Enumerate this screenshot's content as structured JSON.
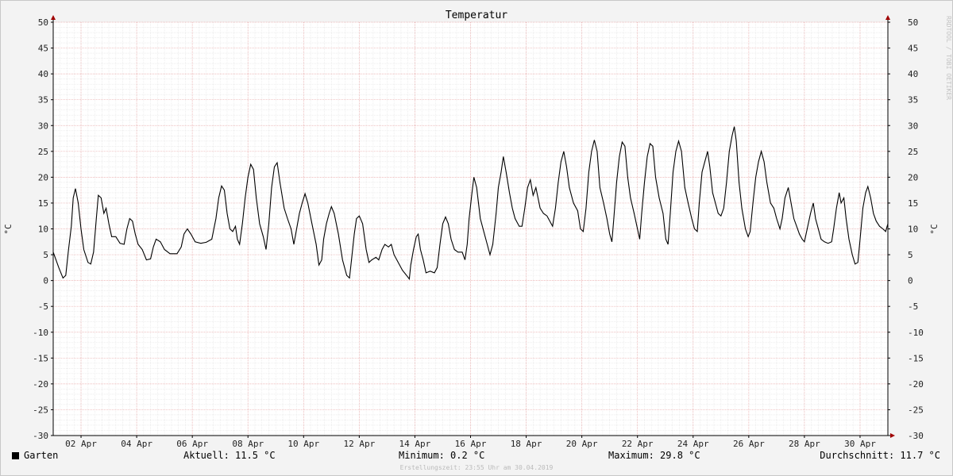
{
  "chart_data": {
    "type": "line",
    "title": "Temperatur",
    "ylabel": "°C",
    "ylabel_right": "°C",
    "ylim": [
      -30,
      50
    ],
    "yticks": [
      50,
      45,
      40,
      35,
      30,
      25,
      20,
      15,
      10,
      5,
      0,
      -5,
      -10,
      -15,
      -20,
      -25,
      -30
    ],
    "xlim": [
      1,
      31
    ],
    "xticks": [
      {
        "x": 2,
        "label": "02 Apr"
      },
      {
        "x": 4,
        "label": "04 Apr"
      },
      {
        "x": 6,
        "label": "06 Apr"
      },
      {
        "x": 8,
        "label": "08 Apr"
      },
      {
        "x": 10,
        "label": "10 Apr"
      },
      {
        "x": 12,
        "label": "12 Apr"
      },
      {
        "x": 14,
        "label": "14 Apr"
      },
      {
        "x": 16,
        "label": "16 Apr"
      },
      {
        "x": 18,
        "label": "18 Apr"
      },
      {
        "x": 20,
        "label": "20 Apr"
      },
      {
        "x": 22,
        "label": "22 Apr"
      },
      {
        "x": 24,
        "label": "24 Apr"
      },
      {
        "x": 26,
        "label": "26 Apr"
      },
      {
        "x": 28,
        "label": "28 Apr"
      },
      {
        "x": 30,
        "label": "30 Apr"
      }
    ],
    "grid": true,
    "series": [
      {
        "name": "Garten",
        "color": "#000000",
        "points": [
          [
            1.0,
            5.5
          ],
          [
            1.2,
            2.5
          ],
          [
            1.35,
            0.5
          ],
          [
            1.45,
            1.0
          ],
          [
            1.55,
            6
          ],
          [
            1.65,
            10.5
          ],
          [
            1.72,
            16
          ],
          [
            1.8,
            17.8
          ],
          [
            1.9,
            15
          ],
          [
            2.0,
            10
          ],
          [
            2.1,
            6
          ],
          [
            2.25,
            3.5
          ],
          [
            2.35,
            3.2
          ],
          [
            2.45,
            5.5
          ],
          [
            2.55,
            12
          ],
          [
            2.62,
            16.5
          ],
          [
            2.72,
            16
          ],
          [
            2.82,
            13
          ],
          [
            2.9,
            14
          ],
          [
            3.0,
            11
          ],
          [
            3.1,
            8.5
          ],
          [
            3.25,
            8.5
          ],
          [
            3.4,
            7.2
          ],
          [
            3.55,
            7
          ],
          [
            3.65,
            10
          ],
          [
            3.75,
            12
          ],
          [
            3.85,
            11.5
          ],
          [
            3.95,
            9
          ],
          [
            4.05,
            7
          ],
          [
            4.2,
            6
          ],
          [
            4.35,
            4
          ],
          [
            4.5,
            4.2
          ],
          [
            4.6,
            6.5
          ],
          [
            4.7,
            8
          ],
          [
            4.85,
            7.5
          ],
          [
            5.0,
            6
          ],
          [
            5.2,
            5.2
          ],
          [
            5.45,
            5.2
          ],
          [
            5.6,
            6.5
          ],
          [
            5.7,
            9
          ],
          [
            5.82,
            10
          ],
          [
            5.95,
            9
          ],
          [
            6.1,
            7.5
          ],
          [
            6.3,
            7.2
          ],
          [
            6.5,
            7.4
          ],
          [
            6.7,
            8
          ],
          [
            6.85,
            12
          ],
          [
            6.95,
            16
          ],
          [
            7.05,
            18.3
          ],
          [
            7.15,
            17.5
          ],
          [
            7.25,
            13
          ],
          [
            7.35,
            10
          ],
          [
            7.45,
            9.5
          ],
          [
            7.55,
            10.5
          ],
          [
            7.62,
            8
          ],
          [
            7.7,
            7
          ],
          [
            7.8,
            11
          ],
          [
            7.9,
            16
          ],
          [
            8.0,
            20
          ],
          [
            8.1,
            22.5
          ],
          [
            8.2,
            21.5
          ],
          [
            8.3,
            16
          ],
          [
            8.42,
            11
          ],
          [
            8.55,
            8.5
          ],
          [
            8.65,
            6
          ],
          [
            8.75,
            11
          ],
          [
            8.85,
            18
          ],
          [
            8.95,
            22
          ],
          [
            9.05,
            22.8
          ],
          [
            9.15,
            19
          ],
          [
            9.3,
            14
          ],
          [
            9.42,
            12
          ],
          [
            9.55,
            10
          ],
          [
            9.65,
            7
          ],
          [
            9.75,
            10
          ],
          [
            9.85,
            13
          ],
          [
            9.95,
            15
          ],
          [
            10.05,
            16.8
          ],
          [
            10.15,
            15
          ],
          [
            10.3,
            11
          ],
          [
            10.45,
            7
          ],
          [
            10.55,
            3
          ],
          [
            10.65,
            4
          ],
          [
            10.72,
            8
          ],
          [
            10.82,
            11
          ],
          [
            10.92,
            13
          ],
          [
            11.0,
            14.3
          ],
          [
            11.1,
            13
          ],
          [
            11.25,
            9
          ],
          [
            11.4,
            4
          ],
          [
            11.55,
            1
          ],
          [
            11.65,
            0.5
          ],
          [
            11.72,
            4
          ],
          [
            11.82,
            9
          ],
          [
            11.9,
            12
          ],
          [
            12.0,
            12.5
          ],
          [
            12.12,
            11
          ],
          [
            12.25,
            6
          ],
          [
            12.35,
            3.5
          ],
          [
            12.45,
            4
          ],
          [
            12.6,
            4.5
          ],
          [
            12.7,
            4
          ],
          [
            12.82,
            6
          ],
          [
            12.92,
            7
          ],
          [
            13.05,
            6.5
          ],
          [
            13.15,
            7
          ],
          [
            13.25,
            5
          ],
          [
            13.4,
            3.5
          ],
          [
            13.55,
            2
          ],
          [
            13.7,
            1
          ],
          [
            13.8,
            0.3
          ],
          [
            13.85,
            3
          ],
          [
            13.95,
            6
          ],
          [
            14.05,
            8.5
          ],
          [
            14.12,
            9
          ],
          [
            14.2,
            6
          ],
          [
            14.3,
            4
          ],
          [
            14.4,
            1.5
          ],
          [
            14.55,
            1.8
          ],
          [
            14.7,
            1.5
          ],
          [
            14.8,
            2.5
          ],
          [
            14.9,
            7
          ],
          [
            15.0,
            11
          ],
          [
            15.1,
            12.3
          ],
          [
            15.2,
            11
          ],
          [
            15.3,
            8
          ],
          [
            15.42,
            6
          ],
          [
            15.55,
            5.5
          ],
          [
            15.7,
            5.5
          ],
          [
            15.8,
            4
          ],
          [
            15.88,
            7
          ],
          [
            15.95,
            12
          ],
          [
            16.05,
            17
          ],
          [
            16.12,
            20
          ],
          [
            16.22,
            18
          ],
          [
            16.35,
            12
          ],
          [
            16.5,
            9
          ],
          [
            16.6,
            7
          ],
          [
            16.7,
            5
          ],
          [
            16.8,
            7
          ],
          [
            16.92,
            13
          ],
          [
            17.0,
            18
          ],
          [
            17.1,
            21
          ],
          [
            17.18,
            24
          ],
          [
            17.28,
            21
          ],
          [
            17.4,
            17
          ],
          [
            17.5,
            14
          ],
          [
            17.6,
            12
          ],
          [
            17.75,
            10.5
          ],
          [
            17.85,
            10.5
          ],
          [
            17.95,
            14
          ],
          [
            18.05,
            18
          ],
          [
            18.15,
            19.5
          ],
          [
            18.25,
            16.5
          ],
          [
            18.35,
            18
          ],
          [
            18.5,
            14
          ],
          [
            18.62,
            13
          ],
          [
            18.75,
            12.5
          ],
          [
            18.85,
            11.5
          ],
          [
            18.95,
            10.5
          ],
          [
            19.05,
            14
          ],
          [
            19.15,
            19
          ],
          [
            19.25,
            23
          ],
          [
            19.35,
            25
          ],
          [
            19.45,
            22
          ],
          [
            19.55,
            18
          ],
          [
            19.7,
            15
          ],
          [
            19.85,
            13.5
          ],
          [
            19.95,
            10
          ],
          [
            20.05,
            9.5
          ],
          [
            20.15,
            14
          ],
          [
            20.25,
            21
          ],
          [
            20.35,
            25
          ],
          [
            20.45,
            27.2
          ],
          [
            20.55,
            25
          ],
          [
            20.65,
            18
          ],
          [
            20.78,
            15
          ],
          [
            20.9,
            12
          ],
          [
            21.0,
            9
          ],
          [
            21.08,
            7.5
          ],
          [
            21.15,
            12
          ],
          [
            21.25,
            19
          ],
          [
            21.35,
            24
          ],
          [
            21.45,
            26.8
          ],
          [
            21.55,
            26
          ],
          [
            21.65,
            20
          ],
          [
            21.75,
            16
          ],
          [
            21.88,
            13
          ],
          [
            22.0,
            10
          ],
          [
            22.08,
            8
          ],
          [
            22.15,
            13
          ],
          [
            22.25,
            19
          ],
          [
            22.35,
            24
          ],
          [
            22.45,
            26.5
          ],
          [
            22.55,
            26
          ],
          [
            22.65,
            20
          ],
          [
            22.78,
            16
          ],
          [
            22.92,
            13
          ],
          [
            23.02,
            8
          ],
          [
            23.1,
            7
          ],
          [
            23.18,
            13
          ],
          [
            23.28,
            21
          ],
          [
            23.38,
            25
          ],
          [
            23.48,
            27
          ],
          [
            23.58,
            25
          ],
          [
            23.7,
            18
          ],
          [
            23.82,
            15
          ],
          [
            23.95,
            12
          ],
          [
            24.05,
            10
          ],
          [
            24.15,
            9.5
          ],
          [
            24.22,
            15
          ],
          [
            24.32,
            21
          ],
          [
            24.42,
            23
          ],
          [
            24.52,
            25
          ],
          [
            24.6,
            22
          ],
          [
            24.7,
            17
          ],
          [
            24.8,
            15
          ],
          [
            24.9,
            13
          ],
          [
            25.0,
            12.5
          ],
          [
            25.1,
            14
          ],
          [
            25.2,
            19
          ],
          [
            25.3,
            25
          ],
          [
            25.4,
            28
          ],
          [
            25.48,
            29.8
          ],
          [
            25.55,
            27
          ],
          [
            25.65,
            19
          ],
          [
            25.75,
            14
          ],
          [
            25.88,
            10
          ],
          [
            25.98,
            8.5
          ],
          [
            26.05,
            9.5
          ],
          [
            26.15,
            15
          ],
          [
            26.25,
            20
          ],
          [
            26.35,
            23
          ],
          [
            26.45,
            25
          ],
          [
            26.55,
            23
          ],
          [
            26.65,
            19
          ],
          [
            26.78,
            15
          ],
          [
            26.9,
            14
          ],
          [
            27.0,
            12
          ],
          [
            27.12,
            10
          ],
          [
            27.2,
            12
          ],
          [
            27.3,
            16
          ],
          [
            27.42,
            18
          ],
          [
            27.52,
            15
          ],
          [
            27.62,
            12
          ],
          [
            27.72,
            10.5
          ],
          [
            27.82,
            9
          ],
          [
            27.92,
            8
          ],
          [
            28.0,
            7.5
          ],
          [
            28.1,
            10
          ],
          [
            28.22,
            13
          ],
          [
            28.32,
            15
          ],
          [
            28.4,
            12
          ],
          [
            28.5,
            10
          ],
          [
            28.6,
            8
          ],
          [
            28.72,
            7.5
          ],
          [
            28.85,
            7.2
          ],
          [
            28.98,
            7.5
          ],
          [
            29.05,
            10
          ],
          [
            29.15,
            14
          ],
          [
            29.25,
            17
          ],
          [
            29.32,
            15
          ],
          [
            29.42,
            16
          ],
          [
            29.5,
            12
          ],
          [
            29.6,
            8
          ],
          [
            29.72,
            5
          ],
          [
            29.82,
            3.2
          ],
          [
            29.92,
            3.5
          ],
          [
            30.0,
            8
          ],
          [
            30.1,
            14
          ],
          [
            30.2,
            17
          ],
          [
            30.28,
            18.2
          ],
          [
            30.38,
            16
          ],
          [
            30.48,
            13
          ],
          [
            30.58,
            11.5
          ],
          [
            30.7,
            10.5
          ],
          [
            30.82,
            10
          ],
          [
            30.92,
            9.5
          ],
          [
            31.0,
            11
          ],
          [
            31.1,
            16
          ],
          [
            31.2,
            20
          ],
          [
            31.28,
            20.8
          ],
          [
            31.38,
            18
          ],
          [
            31.48,
            14
          ],
          [
            31.55,
            11.5
          ]
        ]
      }
    ]
  },
  "legend": {
    "series_name": "Garten",
    "current": "Aktuell: 11.5 °C",
    "minimum": "Minimum: 0.2 °C",
    "maximum": "Maximum: 29.8 °C",
    "average": "Durchschnitt: 11.7 °C"
  },
  "footer": "Erstellungszeit: 23:55 Uhr am 30.04.2019",
  "watermark": "RRDTOOL / TOBI OETIKER"
}
